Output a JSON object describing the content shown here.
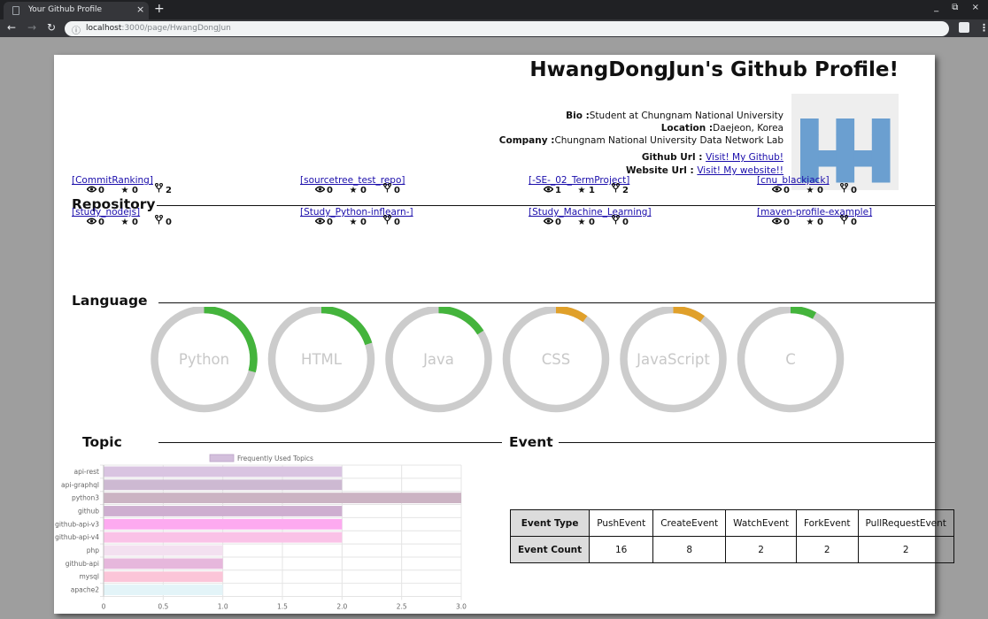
{
  "browser": {
    "tab_title": "Your Github Profile",
    "tab_close": "×",
    "new_tab": "+",
    "window_controls": "_ ⧉ ×",
    "url_host": "localhost",
    "url_rest": ":3000/page/HwangDongJun",
    "icons": [
      "back-arrow-icon",
      "forward-arrow-icon",
      "reload-icon",
      "info-icon",
      "profile-icon",
      "menu-icon"
    ]
  },
  "profile": {
    "title": "HwangDongJun's Github Profile!",
    "bio_label": "Bio :",
    "bio": "Student at Chungnam National University",
    "location_label": "Location :",
    "location": "Daejeon, Korea",
    "company_label": "Company :",
    "company": "Chungnam National University Data Network Lab",
    "github_label": "Github Url : ",
    "github_link": "Visit! My Github!",
    "website_label": "Website Url : ",
    "website_link": " Visit! My website!!",
    "avatar_color": "#6b9fd0"
  },
  "sections": {
    "repository": "Repository",
    "language": "Language",
    "topic": "Topic",
    "event": "Event"
  },
  "repositories": [
    {
      "name": "[CommitRanking]",
      "watchers": "0",
      "stars": "0",
      "forks": "2"
    },
    {
      "name": "[sourcetree_test_repo]",
      "watchers": "0",
      "stars": "0",
      "forks": "0"
    },
    {
      "name": "[-SE-_02_TermProject]",
      "watchers": "1",
      "stars": "1",
      "forks": "2"
    },
    {
      "name": "[cnu_blackjack]",
      "watchers": "0",
      "stars": "0",
      "forks": "0"
    },
    {
      "name": "[study_nodejs]",
      "watchers": "0",
      "stars": "0",
      "forks": "0"
    },
    {
      "name": "[Study_Python-inflearn-]",
      "watchers": "0",
      "stars": "0",
      "forks": "0"
    },
    {
      "name": "[Study_Machine_Learning]",
      "watchers": "0",
      "stars": "0",
      "forks": "0"
    },
    {
      "name": "[maven-profile-example]",
      "watchers": "0",
      "stars": "0",
      "forks": "0"
    }
  ],
  "repo_icons": {
    "watch": "eye-icon",
    "star": "star-icon",
    "fork": "fork-icon"
  },
  "languages": [
    {
      "name": "Python",
      "share": 0.29,
      "color": "#44b43c"
    },
    {
      "name": "HTML",
      "share": 0.2,
      "color": "#44b43c"
    },
    {
      "name": "Java",
      "share": 0.16,
      "color": "#44b43c"
    },
    {
      "name": "CSS",
      "share": 0.1,
      "color": "#e0a02a"
    },
    {
      "name": "JavaScript",
      "share": 0.1,
      "color": "#e0a02a"
    },
    {
      "name": "C",
      "share": 0.08,
      "color": "#44b43c"
    }
  ],
  "language_ring_track_color": "#cccccc",
  "chart_data": {
    "type": "bar",
    "orientation": "horizontal",
    "legend": "Frequently Used Topics",
    "legend_position": "top",
    "categories": [
      "api-rest",
      "api-graphql",
      "python3",
      "github",
      "github-api-v3",
      "github-api-v4",
      "php",
      "github-api",
      "mysql",
      "apache2"
    ],
    "values": [
      2,
      2,
      3,
      2,
      2,
      2,
      1,
      1,
      1,
      1
    ],
    "colors": [
      "#d9c4e1",
      "#cdb9d2",
      "#cbb3c3",
      "#ceaed0",
      "#fdaaf0",
      "#fac2e7",
      "#f3e0f0",
      "#e6b7dc",
      "#fbc5d8",
      "#e3f4f8"
    ],
    "xlim": [
      0,
      3
    ],
    "x_ticks": [
      "0",
      "0.5",
      "1.0",
      "1.5",
      "2.0",
      "2.5",
      "3.0"
    ],
    "grid": true
  },
  "events": {
    "type_label": "Event Type",
    "count_label": "Event Count",
    "types": [
      "PushEvent",
      "CreateEvent",
      "WatchEvent",
      "ForkEvent",
      "PullRequestEvent"
    ],
    "counts": [
      "16",
      "8",
      "2",
      "2",
      "2"
    ]
  }
}
